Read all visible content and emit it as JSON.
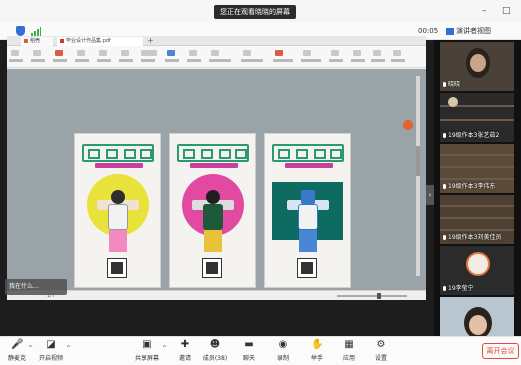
{
  "topbar": {
    "viewing_label": "您正在观看晓晓的屏幕",
    "minimize": "–",
    "maximize": "□"
  },
  "meeting": {
    "timer": "00:05",
    "presenter_view": "演讲者视图",
    "colors": {
      "accent": "#2f6fd6",
      "end": "#e34a3a",
      "signal": "#3bb34a"
    }
  },
  "shared_app": {
    "tab1": "稻壳",
    "tab2": "毕业设计作品集.pdf",
    "status_page": "1/7",
    "tip": "我在什么…"
  },
  "participants": [
    {
      "name": "晓晓",
      "muted": false
    },
    {
      "name": "19级作本3张艺茹2",
      "muted": false
    },
    {
      "name": "19级作本3李伟东",
      "muted": true
    },
    {
      "name": "19级作本3刘美佳员",
      "muted": true
    },
    {
      "name": "19李莹宁",
      "muted": true
    },
    {
      "name": "",
      "muted": true
    }
  ],
  "toolbar": {
    "mute": "静麦克",
    "video": "开启视频",
    "share": "共享屏幕",
    "invite": "邀请",
    "members": "成员(38)",
    "chat": "聊天",
    "record": "录制",
    "raise_hand": "举手",
    "apps": "应用",
    "settings": "设置",
    "leave": "离开会议"
  },
  "icons": [
    "shield-icon",
    "signal-icon",
    "mic-off-icon",
    "camera-off-icon",
    "share-screen-icon",
    "invite-icon",
    "members-icon",
    "chat-icon",
    "record-icon",
    "hand-icon",
    "apps-icon",
    "gear-icon"
  ]
}
